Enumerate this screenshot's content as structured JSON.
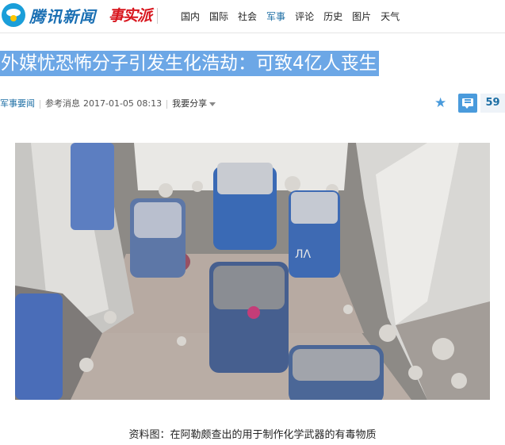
{
  "header": {
    "logo_text": "腾讯新闻",
    "brand": "事实派",
    "nav": [
      "国内",
      "国际",
      "社会",
      "军事",
      "评论",
      "历史",
      "图片",
      "天气"
    ],
    "active_nav": "军事"
  },
  "article": {
    "title": "外媒忧恐怖分子引发生化浩劫：可致4亿人丧生",
    "section": "军事要闻",
    "source": "参考消息",
    "date": "2017-01-05 08:13",
    "share_label": "我要分享",
    "comment_count": "59",
    "caption": "资料图：在阿勒颇查出的用于制作化学武器的有毒物质"
  },
  "colors": {
    "accent": "#1c6ea4",
    "title_highlight": "#6ca7e6",
    "comment_blue": "#4a9bdc",
    "brand_red": "#d8151d"
  }
}
